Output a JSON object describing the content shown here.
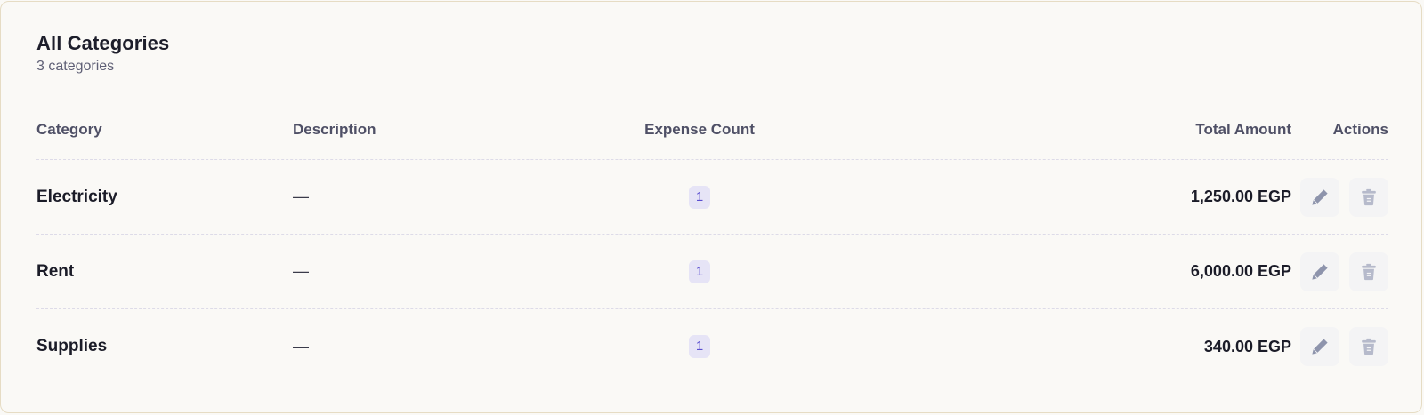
{
  "card": {
    "title": "All Categories",
    "subtitle": "3 categories"
  },
  "table": {
    "headers": {
      "category": "Category",
      "description": "Description",
      "expense_count": "Expense Count",
      "total_amount": "Total Amount",
      "actions": "Actions"
    },
    "rows": [
      {
        "category": "Electricity",
        "description": "—",
        "expense_count": "1",
        "total_amount": "1,250.00 EGP"
      },
      {
        "category": "Rent",
        "description": "—",
        "expense_count": "1",
        "total_amount": "6,000.00 EGP"
      },
      {
        "category": "Supplies",
        "description": "—",
        "expense_count": "1",
        "total_amount": "340.00 EGP"
      }
    ]
  },
  "icons": {
    "edit": "pencil-icon",
    "delete": "trash-icon"
  },
  "colors": {
    "badge_bg": "#e6e4f6",
    "badge_text": "#5b4fd0",
    "edit_icon": "#8e94ac",
    "delete_icon": "#b6bacb",
    "card_border": "#e6dcc4"
  }
}
